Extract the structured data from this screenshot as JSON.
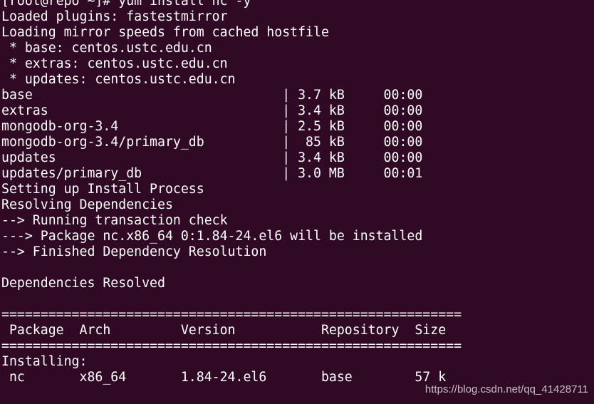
{
  "colors": {
    "background": "#300a24",
    "text": "#ffffff",
    "watermark": "rgba(255,255,255,0.72)"
  },
  "terminal": {
    "lines": [
      "[root@repo ~]# yum install nc -y",
      "Loaded plugins: fastestmirror",
      "Loading mirror speeds from cached hostfile",
      " * base: centos.ustc.edu.cn",
      " * extras: centos.ustc.edu.cn",
      " * updates: centos.ustc.edu.cn",
      "base                                | 3.7 kB     00:00",
      "extras                              | 3.4 kB     00:00",
      "mongodb-org-3.4                     | 2.5 kB     00:00",
      "mongodb-org-3.4/primary_db          |  85 kB     00:00",
      "updates                             | 3.4 kB     00:00",
      "updates/primary_db                  | 3.0 MB     00:01",
      "Setting up Install Process",
      "Resolving Dependencies",
      "--> Running transaction check",
      "---> Package nc.x86_64 0:1.84-24.el6 will be installed",
      "--> Finished Dependency Resolution",
      "",
      "Dependencies Resolved",
      "",
      "===========================================================",
      " Package  Arch         Version           Repository  Size",
      "===========================================================",
      "Installing:",
      " nc       x86_64       1.84-24.el6       base        57 k"
    ]
  },
  "watermark": {
    "text": "https://blog.csdn.net/qq_41428711"
  }
}
